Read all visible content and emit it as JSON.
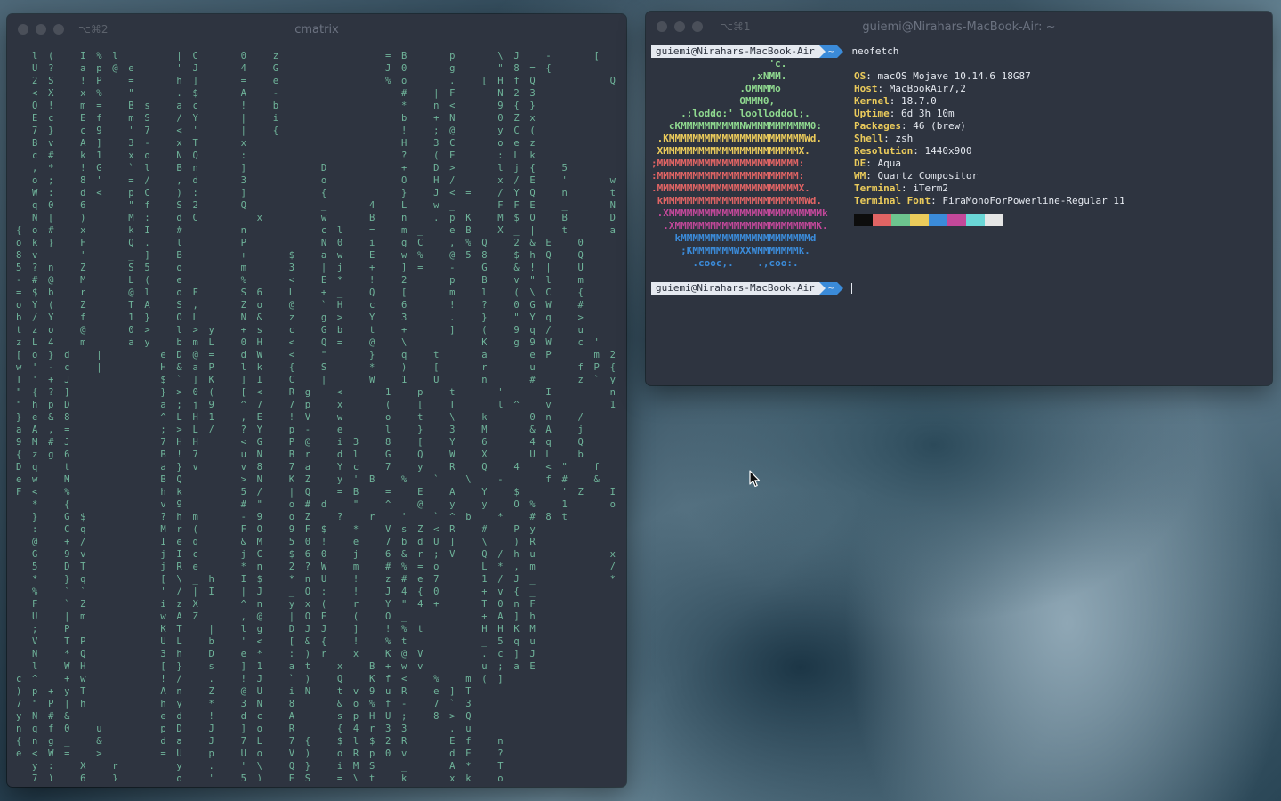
{
  "matrix_window": {
    "title": "cmatrix",
    "shortcut": "⌥⌘2",
    "rows": [
      "  l (   I % l       | C     0   z             = B     p     \\ J _ -     [   a     c   b",
      "  U ?   a p @ e     ' J     4   G             J 0     g     \" 8 = {         K     G   x",
      "  2 S   ! P   =     h ]     =   e             % o     .   [ H f Q         Q     B   {",
      "  < X   x %   \"     . $     A   -               #   | F     N 2 3               -",
      "  Q !   m =   B s   a c     !   b               *   n <     9 { }               e",
      "  E c   E f   m S   / Y     |   i               b   + N     0 Z x               ?",
      "  7 }   c 9   ' 7   < '     |   {               !   ; @     y C (               w",
      "  B v   A ]   3 -   x T     x                   H   3 C     o e z               L",
      "  c #   k 1   x o   N Q     :                   ?   ( E     : L k               W",
      "  , *   ! G   ` l   B n     ]         D         +   D >     l j {   5           $",
      "  o ;   8 '   = /   , d     3         o         O   H /     x / E   '     w     e",
      "  W :   d <   p C   ) :     ]         {         }   J < =   / Y Q   n     t     v",
      "  q 0   6     \" f   S 2     Q         _     4   L   w _     F F E   _     N     &",
      "  N [   )     M :   d C     _ x       w     B   n   . p K   M $ O   B     D     b",
      "{ o #   x     k I   #       n         c l   =   m _   e B   X _ |   t     a     @",
      "o k }   F     Q .   l       P         N 0   i   g C   , % Q   2 & E   0     O E   O",
      "8 v     '     _ ]   B       +     $   a w   E   w %   @ 5 8   $ h Q   Q     R .   l",
      "5 ? n   Z     S 5   o       m     3   | j   +   ] =   -   G   & ! |   U     ' 1   p",
      "- # @   M     L (   e       %     <   E *   !   2     p   B   v \" l   m     J &   $",
      "= $ b   r     @ l   o F     S 6   L   + _   Q   [     m   l   ( \\ C   {     ? k   o",
      "o Y (   Z     T A   S ,     Z o   @   ` H   c   6     !   ?   0 G W   #     - H   _",
      "b / Y   f     1 }   O L     N &   z   g >   Y   3     .   }   \" Y q   >     < p   z",
      "t z o   @     0 >   l > y   + s   c   G b   t   +     ]   (   9 q /   u     4 c w",
      "z L 4   m     a y   b m L   0 H   <   Q =   @   \\         K   g 9 W   c '   I . M",
      "[ o } d   |       e D @ =   d W   <   \"     }   q   t     a     e P     m 2 \\ Y R W     q",
      "w ' - c   |       H & a P   l k   {   S     *   )   [     r     u     f P { P Z .     S     G",
      "T ' + J           $ ` ] K   ] I   C   |     W   1   U     n     #     z ` y 1 ( =     '     =",
      "\" { ? ]           } > 0 (   [ <   R g   <     1   p   t     '     I       n ; c ( g   *     h",
      "\" h p D           a ; j 9   ^ 7   7 p   x     (   [   T     l ^   v       1 o z I ]   e     f",
      "} e & 8           ^ L H 1   , E   ! V   w     o   t   \\   k     0 n   /       $ S 9 X +   A     J 7",
      "a A , =           ; > L /   ? Y   p -   e     l   }   3   M     & A   j       v t % t x   +     /",
      "9 M # J           7 H H     < G   P @   i 3   8   [   Y   6     4 q   Q       z f > * s   B     ]",
      "{ z g 6           B ! 7     u N   B r   d l   G   Q   W   X     U L   b     w   4 1 ' B S   Y     E",
      "D q   t           a } v     v 8   7 a   Y c   7   y   R   Q   4   < \"   f     R   p W 4 & D   a     Y",
      "e w   M           B Q       > N   K Z   y ' B   %   `   \\   -     f #   &     s   7 \" L _ m   ;     e",
      "F <   %           h k       5 /   | Q   = B   =   E   A   Y   $     ' Z   I     k   5 7 [ e 1   ;     R",
      "  *   {           v 9       # \"   o # d   \"   ^   @   y   y   O %   1     o   U ] / w ^   p     Y",
      "  }   G $         ? h m     - 9   o Z   ?   r   '   ` ^ b   *   # 8 t         P   8 / s G ]         T",
      "  :   C q         M r (     F O   9 F $   *   V s Z < R   #   P y           m   I C b l R         `",
      "  @   + /         I e q     & M   5 0 !   e   7 b d U ]   \\   ) R           p   v T 2 A   /     H",
      "  G   9 v         j I c     j C   $ 6 0   j   6 & r ; V   Q / h u         x   > ? W H   H     @",
      "  5   D T         j R e     * n   2 ? W   m   # % = o     L * , m         /   2 0 L     T     X",
      "  *   } q         [ \\ _ h   I $   * n U   !   z # e 7     1 / J _         *   1 / z     V   h C",
      "  %   ` `         ' / | I   | J   _ O :   !   J 4 { 0     + v { _           ' z 8 2     +   T Y",
      "  F   ` Z         i z X     ^ n   y x (   r   Y \" 4 +     T 0 n F           r / \" z     B   \\ o",
      "  U   | m         w A Z     , @   | O E   (   O _         + A ] h           ( \\ / m {   _   ] q",
      "  ;   P           K T   |   l g   D J J   ]   ! % t       H H K M           H b . u ?   .   l S",
      "  V   T P         U L   b   ' <   [ & {   !   % t         _ 5 q u           > o U k -   s   4 W W A",
      "  N   * Q         3 h   D   e *   : ) r   x   K @ V       . c ] J           K i i O (   O   U W S R",
      "  l   W H         [ }   s   ] 1   a t   x   B + w v       u ; a E           _ D s \\ 3   3   + [ + 2",
      "c ^   + w         ! /   .   ! J   ` )   Q   K f < _ %   m ( ]               ` g O W E   8   e I 3 F",
      ") p + y T         A n   Z   @ U   i N   t v 9 u R   e ] T                   M O } K !   !   ' U ) 3",
      "7 \" P | h         h y   *   3 N   8     & o % f -   7 ` 3                   w x R / &   ,   \\ A 7 u",
      "y N # &           e d   !   d c   A     s p H U ;   8 > Q                   a Q (       j   l 6 j 5",
      "n q f 0   u       p D   J   ] o   R     { 4 r 3 3     . u                   Y [ g       '   5 X - }",
      "{ n g _   &       d a   J   7 L   7 {   $ l $ 2 R     E f   n               I . J       :   j X l !",
      "e < W =   >       = U   p   U o   V )   o R p 0 v     d E   ?               n 2 T       A   Y . u s",
      "  y :   X   r       y   .   ' \\   Q }   i M S   _     A *   T               d P v       a   F c   s",
      "  7 )   6   }       o   '   5 )   E S   = \\ t   k     x k   o               W 5 y       K   Y y   ="
    ]
  },
  "terminal_window": {
    "title": "guiemi@Nirahars-MacBook-Air: ~",
    "shortcut": "⌥⌘1",
    "prompt_host": "guiemi@Nirahars-MacBook-Air",
    "prompt_dir": "~",
    "command": "neofetch",
    "logo_lines": [
      {
        "text": "                    'c.",
        "color": "#8fd98f"
      },
      {
        "text": "                 ,xNMM.",
        "color": "#8fd98f"
      },
      {
        "text": "               .OMMMMo",
        "color": "#8fd98f"
      },
      {
        "text": "               OMMM0,",
        "color": "#8fd98f"
      },
      {
        "text": "     .;loddo:' loolloddol;.",
        "color": "#8fd98f"
      },
      {
        "text": "   cKMMMMMMMMMMNWMMMMMMMMMM0:",
        "color": "#8fd98f"
      },
      {
        "text": " .KMMMMMMMMMMMMMMMMMMMMMMMWd.",
        "color": "#ebcb5b"
      },
      {
        "text": " XMMMMMMMMMMMMMMMMMMMMMMMX.",
        "color": "#ebcb5b"
      },
      {
        "text": ";MMMMMMMMMMMMMMMMMMMMMMMM:",
        "color": "#e06464"
      },
      {
        "text": ":MMMMMMMMMMMMMMMMMMMMMMMM:",
        "color": "#e06464"
      },
      {
        "text": ".MMMMMMMMMMMMMMMMMMMMMMMMX.",
        "color": "#e06464"
      },
      {
        "text": " kMMMMMMMMMMMMMMMMMMMMMMMMWd.",
        "color": "#e06464"
      },
      {
        "text": " .XMMMMMMMMMMMMMMMMMMMMMMMMMMk",
        "color": "#c3489a"
      },
      {
        "text": "  .XMMMMMMMMMMMMMMMMMMMMMMMMK.",
        "color": "#c3489a"
      },
      {
        "text": "    kMMMMMMMMMMMMMMMMMMMMMMd",
        "color": "#3b8bd9"
      },
      {
        "text": "     ;KMMMMMMMWXXWMMMMMMMk.",
        "color": "#3b8bd9"
      },
      {
        "text": "       .cooc,.    .,coo:.",
        "color": "#3b8bd9"
      }
    ],
    "info": [
      {
        "key": "",
        "value": ""
      },
      {
        "key": "OS",
        "value": "macOS Mojave 10.14.6 18G87"
      },
      {
        "key": "Host",
        "value": "MacBookAir7,2"
      },
      {
        "key": "Kernel",
        "value": "18.7.0"
      },
      {
        "key": "Uptime",
        "value": "6d 3h 10m"
      },
      {
        "key": "Packages",
        "value": "46 (brew)"
      },
      {
        "key": "Shell",
        "value": "zsh"
      },
      {
        "key": "Resolution",
        "value": "1440x900"
      },
      {
        "key": "DE",
        "value": "Aqua"
      },
      {
        "key": "WM",
        "value": "Quartz Compositor"
      },
      {
        "key": "Terminal",
        "value": "iTerm2"
      },
      {
        "key": "Terminal Font",
        "value": "FiraMonoForPowerline-Regular 11"
      }
    ],
    "palette": [
      "#0d0d0d",
      "#e06464",
      "#6dc48e",
      "#ebcb5b",
      "#3b8bd9",
      "#c3489a",
      "#6ad6d6",
      "#e5e5e5"
    ]
  },
  "desktop": {
    "cursor_icon": "mouse-pointer-icon"
  }
}
